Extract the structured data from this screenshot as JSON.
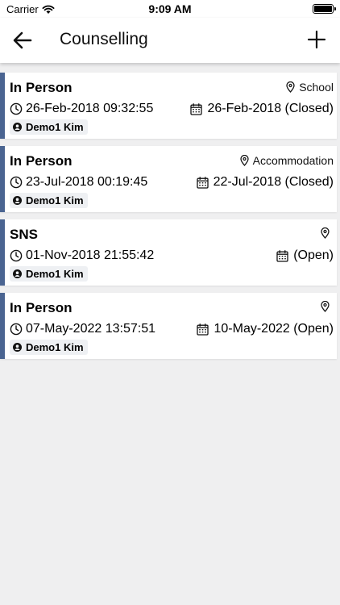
{
  "status_bar": {
    "carrier": "Carrier",
    "time": "9:09 AM",
    "battery_level": 1.0
  },
  "header": {
    "title": "Counselling",
    "back_icon": "arrow-left-icon",
    "add_icon": "plus-icon"
  },
  "sessions": [
    {
      "mode": "In Person",
      "location": "School",
      "start": "26-Feb-2018 09:32:55",
      "end": "26-Feb-2018 (Closed)",
      "person": "Demo1 Kim"
    },
    {
      "mode": "In Person",
      "location": "Accommodation",
      "start": "23-Jul-2018 00:19:45",
      "end": "22-Jul-2018 (Closed)",
      "person": "Demo1 Kim"
    },
    {
      "mode": "SNS",
      "location": "",
      "start": "01-Nov-2018 21:55:42",
      "end": "(Open)",
      "person": "Demo1 Kim"
    },
    {
      "mode": "In Person",
      "location": "",
      "start": "07-May-2022 13:57:51",
      "end": "10-May-2022 (Open)",
      "person": "Demo1 Kim"
    }
  ],
  "colors": {
    "accent": "#4a6491",
    "background": "#efeff0"
  }
}
